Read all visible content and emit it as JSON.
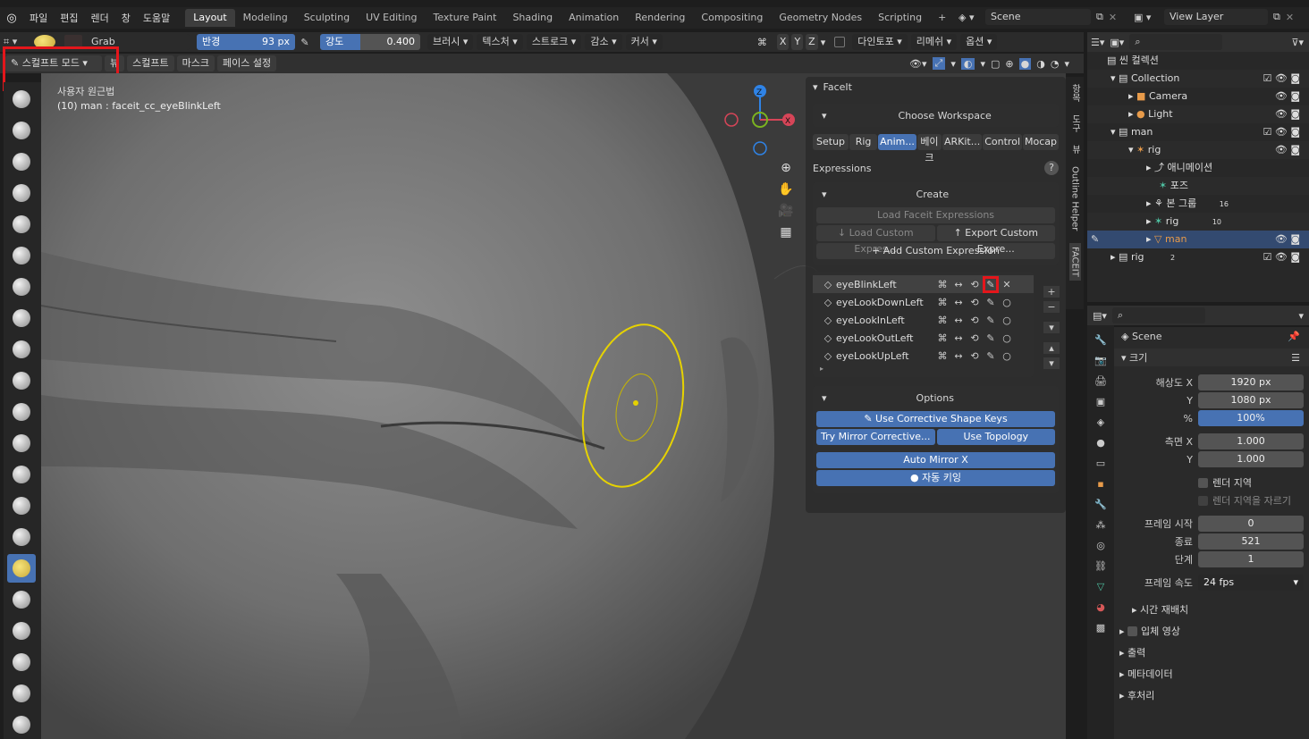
{
  "menu": [
    "파일",
    "편집",
    "렌더",
    "창",
    "도움말"
  ],
  "workspaces": [
    "Layout",
    "Modeling",
    "Sculpting",
    "UV Editing",
    "Texture Paint",
    "Shading",
    "Animation",
    "Rendering",
    "Compositing",
    "Geometry Nodes",
    "Scripting"
  ],
  "active_workspace": "Layout",
  "scene": "Scene",
  "view_layer": "View Layer",
  "toolrow": {
    "brush": "Grab",
    "radius_label": "반경",
    "radius_value": "93 px",
    "strength_label": "강도",
    "strength_value": "0.400",
    "menus": [
      "브러시",
      "텍스처",
      "스트로크",
      "감소",
      "커서"
    ],
    "axes": [
      "X",
      "Y",
      "Z"
    ],
    "dyntopo": "다인토포",
    "remesh": "리메쉬",
    "options": "옵션"
  },
  "moderow": {
    "mode": "스컬프트 모드",
    "view": "뷰",
    "sculpt": "스컬프트",
    "mask": "마스크",
    "face_sets": "페이스 설정"
  },
  "viewport": {
    "line1": "사용자 원근법",
    "line2": "(10) man : faceit_cc_eyeBlinkLeft"
  },
  "faceit": {
    "title": "FaceIt",
    "workspace": "Choose Workspace",
    "tabs": [
      "Setup",
      "Rig",
      "Anim...",
      "베이크",
      "ARKit...",
      "Control",
      "Mocap"
    ],
    "expressions": "Expressions",
    "create": "Create",
    "load_faceit": "Load Faceit Expressions",
    "load_custom": "Load Custom Expres...",
    "export_custom": "Export Custom Expre...",
    "add_custom": "Add Custom Expression",
    "list": [
      "eyeBlinkLeft",
      "eyeLookDownLeft",
      "eyeLookInLeft",
      "eyeLookOutLeft",
      "eyeLookUpLeft"
    ],
    "options": "Options",
    "use_corrective": "Use Corrective Shape Keys",
    "try_mirror": "Try Mirror Corrective...",
    "use_topology": "Use Topology",
    "auto_mirror": "Auto Mirror X",
    "auto_key": "자동 키잉"
  },
  "side_tabs": [
    "항목",
    "도구",
    "뷰",
    "Outline Helper",
    "FACEIT"
  ],
  "outliner": {
    "root": "씬 컬렉션",
    "items": [
      {
        "label": "Collection",
        "indent": 0
      },
      {
        "label": "Camera",
        "indent": 1
      },
      {
        "label": "Light",
        "indent": 1
      },
      {
        "label": "man",
        "indent": 0
      },
      {
        "label": "rig",
        "indent": 1
      },
      {
        "label": "애니메이션",
        "indent": 2
      },
      {
        "label": "포즈",
        "indent": 2
      },
      {
        "label": "본 그룹",
        "indent": 2
      },
      {
        "label": "rig",
        "indent": 2
      },
      {
        "label": "man",
        "indent": 2
      },
      {
        "label": "rig",
        "indent": 0
      }
    ],
    "badges": {
      "bone_groups": "16",
      "rig_count": "10",
      "rig_sub": "2"
    }
  },
  "props": {
    "scene": "Scene",
    "section_size": "크기",
    "res_x_label": "해상도 X",
    "res_x": "1920 px",
    "res_y_label": "Y",
    "res_y": "1080 px",
    "pct_label": "%",
    "pct": "100%",
    "aspect_x_label": "측면 X",
    "aspect_x": "1.000",
    "aspect_y_label": "Y",
    "aspect_y": "1.000",
    "render_region": "렌더 지역",
    "crop_region": "렌더 지역을 자르기",
    "frame_start_label": "프레임 시작",
    "frame_start": "0",
    "frame_end_label": "종료",
    "frame_end": "521",
    "frame_step_label": "단계",
    "frame_step": "1",
    "fps_label": "프레임 속도",
    "fps": "24 fps",
    "time_remap": "시간 재배치",
    "stereo": "입체 영상",
    "output": "출력",
    "metadata": "메타데이터",
    "post": "후처리"
  }
}
